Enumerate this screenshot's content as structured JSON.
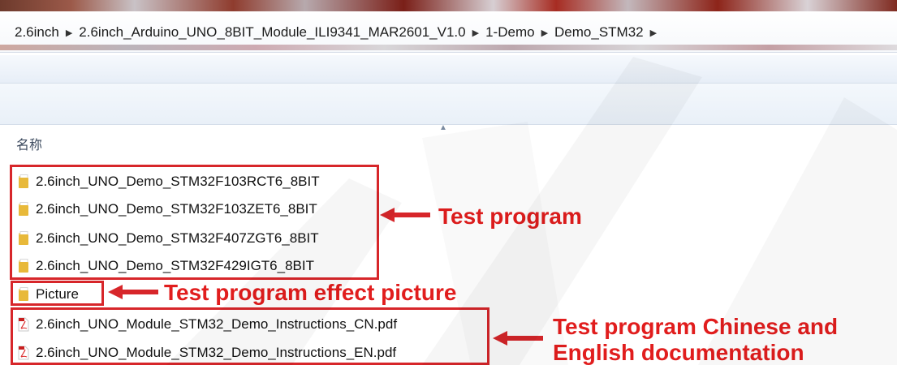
{
  "breadcrumb": [
    "2.6inch",
    "2.6inch_Arduino_UNO_8BIT_Module_ILI9341_MAR2601_V1.0",
    "1-Demo",
    "Demo_STM32"
  ],
  "header": {
    "name_col": "名称"
  },
  "files": [
    {
      "name": "2.6inch_UNO_Demo_STM32F103RCT6_8BIT",
      "type": "folder"
    },
    {
      "name": "2.6inch_UNO_Demo_STM32F103ZET6_8BIT",
      "type": "folder"
    },
    {
      "name": "2.6inch_UNO_Demo_STM32F407ZGT6_8BIT",
      "type": "folder"
    },
    {
      "name": "2.6inch_UNO_Demo_STM32F429IGT6_8BIT",
      "type": "folder"
    },
    {
      "name": "Picture",
      "type": "folder"
    },
    {
      "name": "2.6inch_UNO_Module_STM32_Demo_Instructions_CN.pdf",
      "type": "pdf"
    },
    {
      "name": "2.6inch_UNO_Module_STM32_Demo_Instructions_EN.pdf",
      "type": "pdf"
    }
  ],
  "annotations": {
    "test_program": "Test program",
    "picture": "Test program effect picture",
    "docs_line1": "Test program Chinese and",
    "docs_line2": "English documentation"
  },
  "colors": {
    "annotation_red": "#e11d1d",
    "folder_yellow": "#e8b93a"
  }
}
